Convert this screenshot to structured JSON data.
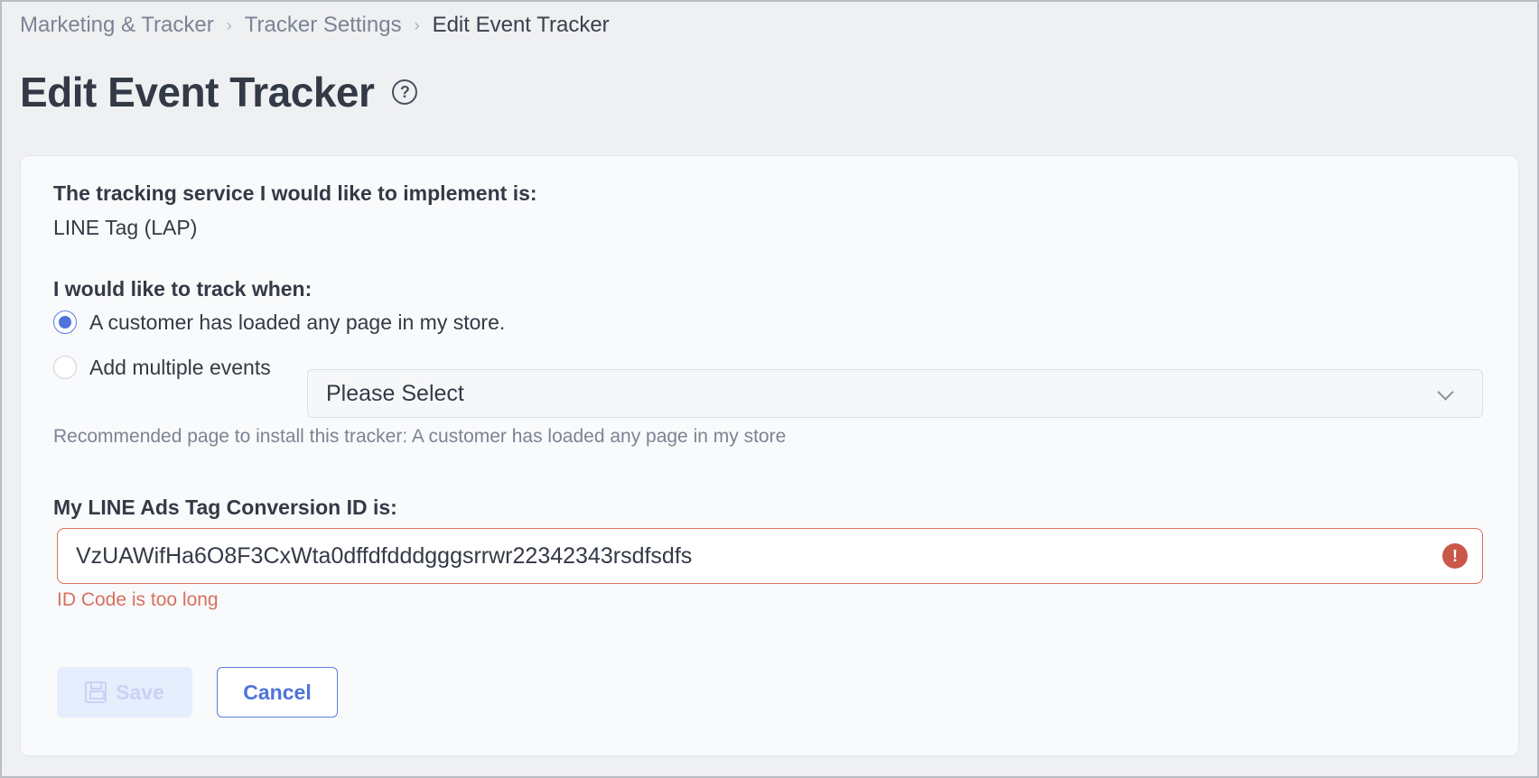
{
  "breadcrumb": {
    "items": [
      "Marketing & Tracker",
      "Tracker Settings",
      "Edit Event Tracker"
    ],
    "separator": "›"
  },
  "page": {
    "title": "Edit Event Tracker",
    "help_icon": "question-circle-icon"
  },
  "form": {
    "service_label": "The tracking service I would like to implement is:",
    "service_value": "LINE Tag (LAP)",
    "track_label": "I would like to track when:",
    "options": [
      {
        "label": "A customer has loaded any page in my store.",
        "checked": true
      },
      {
        "label": "Add multiple events",
        "checked": false
      }
    ],
    "events_select": {
      "value": "Please Select"
    },
    "recommended_hint": "Recommended page to install this tracker: A customer has loaded any page in my store",
    "conversion_label": "My LINE Ads Tag Conversion ID is:",
    "conversion_value": "VzUAWifHa6O8F3CxWta0dffdfdddgggsrrwr22342343rsdfsdfs",
    "error_message": "ID Code is too long",
    "error_icon": "exclamation-circle-icon"
  },
  "actions": {
    "save_label": "Save",
    "cancel_label": "Cancel"
  },
  "colors": {
    "accent": "#4f73db",
    "error": "#d9705e",
    "background": "#eff0f2"
  }
}
